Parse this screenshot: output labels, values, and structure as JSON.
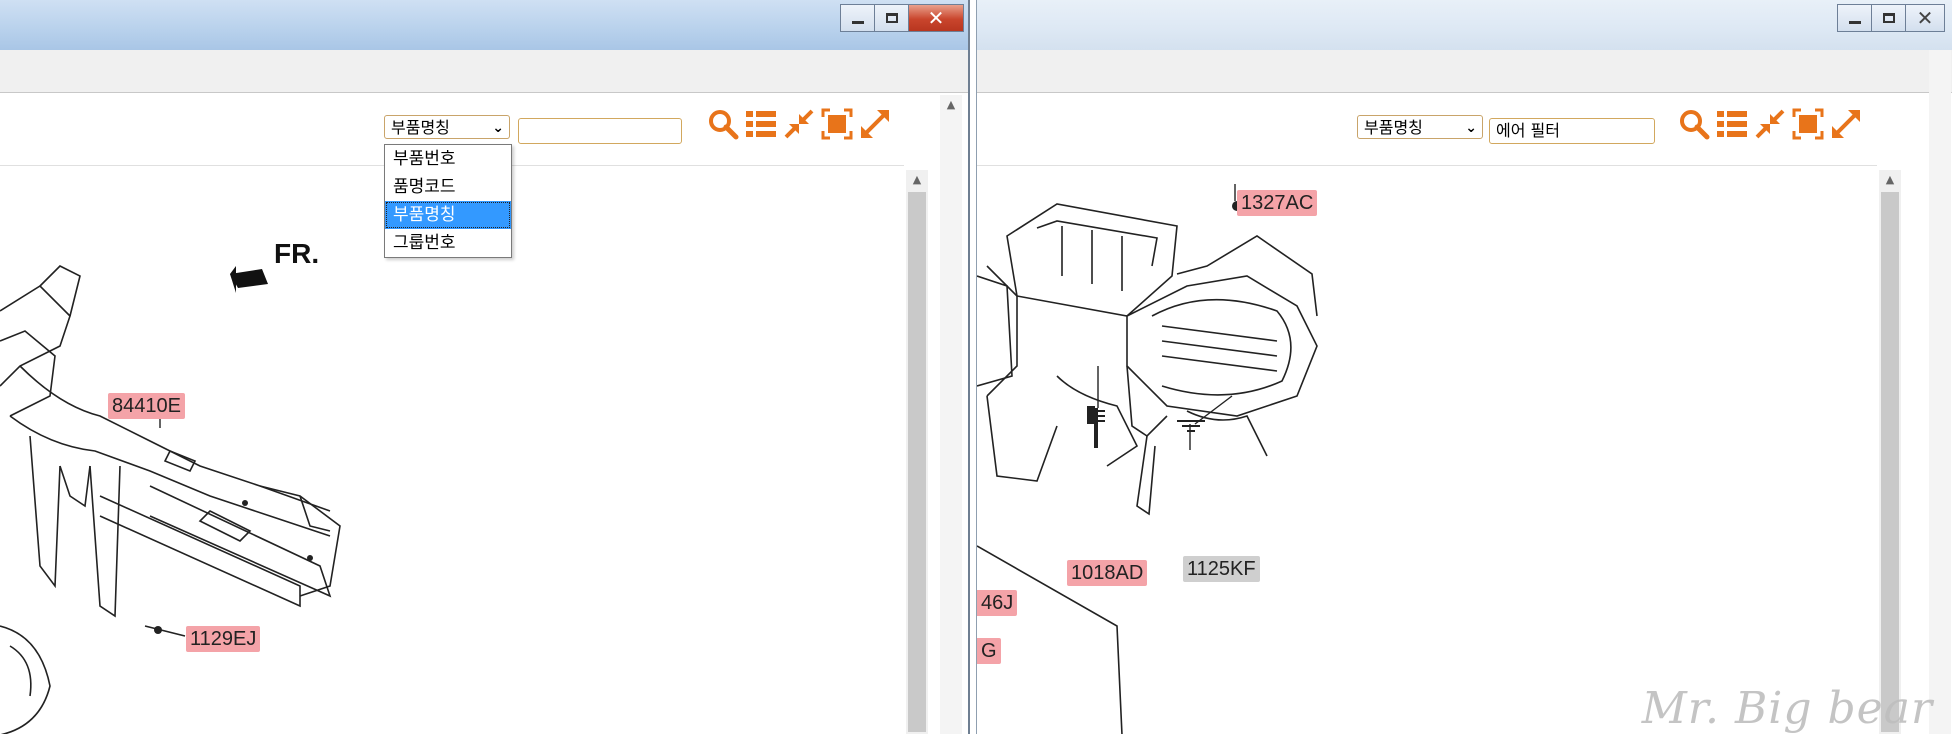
{
  "left_window": {
    "search_field_select": "부품명칭",
    "search_input_value": "",
    "dropdown_options": [
      "부품번호",
      "품명코드",
      "부품명칭",
      "그룹번호"
    ],
    "dropdown_selected_index": 2,
    "direction_label": "FR.",
    "part_labels": {
      "label_1": "84410E",
      "label_2": "1129EJ"
    }
  },
  "right_window": {
    "search_field_select": "부품명칭",
    "search_input_value": "에어 필터",
    "part_labels": {
      "label_1": "1327AC",
      "label_2": "1018AD",
      "label_3": "1125KF",
      "label_4": "46J",
      "label_5": "G"
    }
  },
  "caption_buttons": {
    "close": "✕"
  },
  "watermark": "Mr. Big bear",
  "colors": {
    "accent_orange": "#e8741a",
    "label_pink": "#f4a3a8",
    "label_gray": "#cfcfcf"
  }
}
